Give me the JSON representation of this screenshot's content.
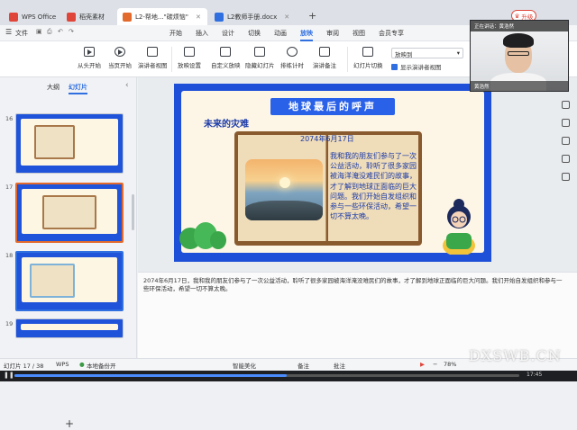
{
  "titlebar": {
    "tabs": [
      {
        "label": "WPS Office",
        "color": "#e0453a"
      },
      {
        "label": "稻壳素材",
        "color": "#e0453a"
      },
      {
        "label": "L2-帮地...\"碳烦恼\"",
        "color": "#e36a2d"
      },
      {
        "label": "L2教师手册.docx",
        "color": "#2f6fe0"
      }
    ],
    "new_tab": "+",
    "upgrade": "升级"
  },
  "menubar": {
    "file": "文件",
    "items": [
      "开始",
      "插入",
      "设计",
      "切换",
      "动画",
      "放映",
      "审阅",
      "视图",
      "会员专享"
    ],
    "active": "放映"
  },
  "ribbon": {
    "buttons": [
      "从头开始",
      "当页开始",
      "演讲者视图",
      "放映设置",
      "自定义放映",
      "隐藏幻灯片",
      "排练计时",
      "演讲备注",
      "幻灯片切换"
    ],
    "select_value": "放映到",
    "checkbox_label": "显示演讲者视图"
  },
  "leftpanel": {
    "tabs": [
      "大纲",
      "幻灯片"
    ],
    "active_tab": "幻灯片",
    "slides": [
      {
        "num": "16"
      },
      {
        "num": "17"
      },
      {
        "num": "18"
      },
      {
        "num": "19"
      }
    ],
    "add": "+"
  },
  "slide": {
    "title": "地球最后的呼声",
    "left_title": "未来的灾难",
    "date": "2074年6月17日",
    "body": "我和我的朋友们参与了一次公益活动，聆听了很多家园被海洋淹没难民们的故事，才了解到地球正面临的巨大问题。我们开始自发组织和参与一些环保活动，希望一切不算太晚。"
  },
  "notes": {
    "text": "2074年6月17日，我和我的朋友们参与了一次公益活动，聆听了很多家园被海洋淹没难民们的故事，才了解到地球正面临的巨大问题。我们开始自发组织和参与一些环保活动，希望一切不算太晚。"
  },
  "statusbar": {
    "slide_pos": "幻灯片 17 / 38",
    "theme": "WPS",
    "backup": "本地备份开",
    "beautify": "智能美化",
    "notes": "备注",
    "comments": "批注",
    "zoom": "78%"
  },
  "video": {
    "progress": 0.54,
    "time": "17:45"
  },
  "webcam": {
    "top_text": "正在讲话：黄浩然",
    "bottom_text": "黄浩然"
  },
  "watermark": "DXSWB.CN"
}
